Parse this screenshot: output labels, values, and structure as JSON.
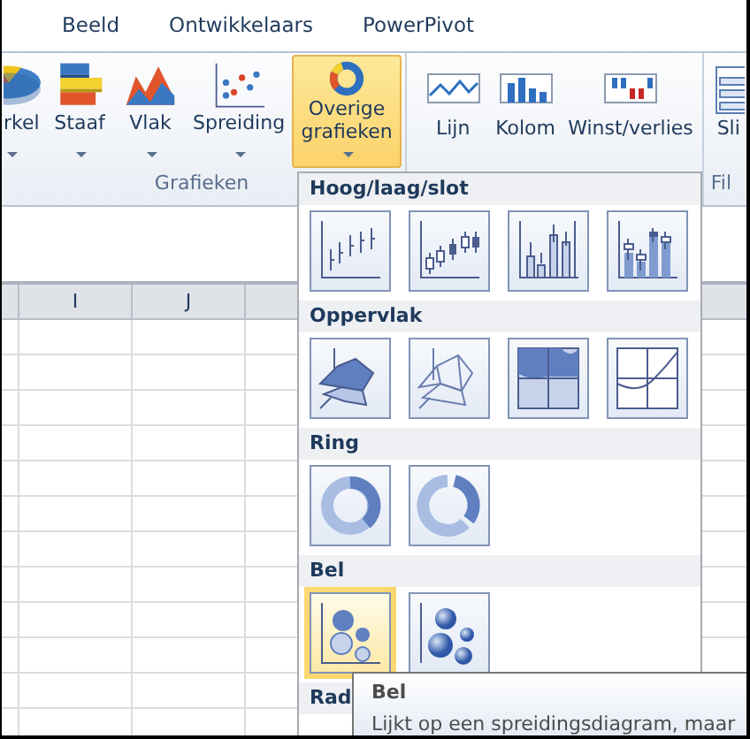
{
  "tabs": [
    {
      "label": "Beeld",
      "selected": false
    },
    {
      "label": "Ontwikkelaars",
      "selected": false
    },
    {
      "label": "PowerPivot",
      "selected": false
    }
  ],
  "ribbon": {
    "groups": [
      {
        "label": "Grafieken",
        "buttons": [
          {
            "label": "rkel",
            "kind": "pie",
            "has_menu": true,
            "selected": false
          },
          {
            "label": "Staaf",
            "kind": "bar",
            "has_menu": true,
            "selected": false
          },
          {
            "label": "Vlak",
            "kind": "area",
            "has_menu": true,
            "selected": false
          },
          {
            "label": "Spreiding",
            "kind": "scatter",
            "has_menu": true,
            "selected": false
          },
          {
            "label": "Overige grafieken",
            "kind": "doughnut",
            "has_menu": true,
            "selected": true
          }
        ]
      },
      {
        "buttons": [
          {
            "label": "Lijn",
            "kind": "spark-line",
            "has_menu": false,
            "selected": false
          },
          {
            "label": "Kolom",
            "kind": "spark-column",
            "has_menu": false,
            "selected": false
          },
          {
            "label": "Winst/verlies",
            "kind": "spark-winloss",
            "has_menu": false,
            "selected": false
          }
        ]
      },
      {
        "label": "Fil",
        "buttons": [
          {
            "label": "Sli",
            "kind": "slicer",
            "has_menu": false,
            "selected": false
          }
        ]
      }
    ]
  },
  "sheet": {
    "columns": [
      {
        "label": "I"
      },
      {
        "label": "J"
      }
    ]
  },
  "gallery": {
    "sections": [
      {
        "title": "Hoog/laag/slot",
        "items": [
          {
            "kind": "hlc",
            "selected": false
          },
          {
            "kind": "ohlc",
            "selected": false
          },
          {
            "kind": "vhlc",
            "selected": false
          },
          {
            "kind": "vohlc",
            "selected": false
          }
        ]
      },
      {
        "title": "Oppervlak",
        "items": [
          {
            "kind": "surface",
            "selected": false
          },
          {
            "kind": "wireframe",
            "selected": false
          },
          {
            "kind": "contour",
            "selected": false
          },
          {
            "kind": "wirecontour",
            "selected": false
          }
        ]
      },
      {
        "title": "Ring",
        "items": [
          {
            "kind": "doughnut",
            "selected": false
          },
          {
            "kind": "exploded",
            "selected": false
          }
        ]
      },
      {
        "title": "Bel",
        "items": [
          {
            "kind": "bubble",
            "selected": true
          },
          {
            "kind": "bubble3d",
            "selected": false
          }
        ]
      },
      {
        "title": "Rad"
      }
    ]
  },
  "tooltip": {
    "title": "Bel",
    "text": "Lijkt op een spreidingsdiagram, maar"
  }
}
